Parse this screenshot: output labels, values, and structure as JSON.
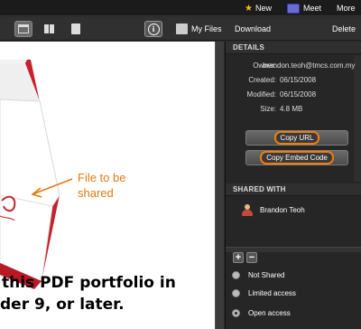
{
  "topbar": {
    "new": "New",
    "meet": "Meet",
    "more": "More"
  },
  "toolbar": {
    "my_files": "My Files",
    "download": "Download",
    "delete": "Delete"
  },
  "document": {
    "callout": [
      "File to be",
      "shared"
    ],
    "text_lines": [
      "this PDF portfolio in",
      "der 9, or later."
    ]
  },
  "details": {
    "heading": "DETAILS",
    "owner_label": "Owner:",
    "owner": "brandon.teoh@tmcs.com.my",
    "created_label": "Created:",
    "created": "06/15/2008",
    "modified_label": "Modified:",
    "modified": "06/15/2008",
    "size_label": "Size:",
    "size": "4.8 MB",
    "copy_url": "Copy URL",
    "copy_embed": "Copy Embed Code"
  },
  "shared_with": {
    "heading": "SHARED WITH",
    "users": [
      "Brandon Teoh"
    ],
    "options": [
      "Not Shared",
      "Limited access",
      "Open access"
    ],
    "selected": "Open access"
  },
  "colors": {
    "accent": "#ef7d10",
    "doc_red": "#c8202a"
  }
}
